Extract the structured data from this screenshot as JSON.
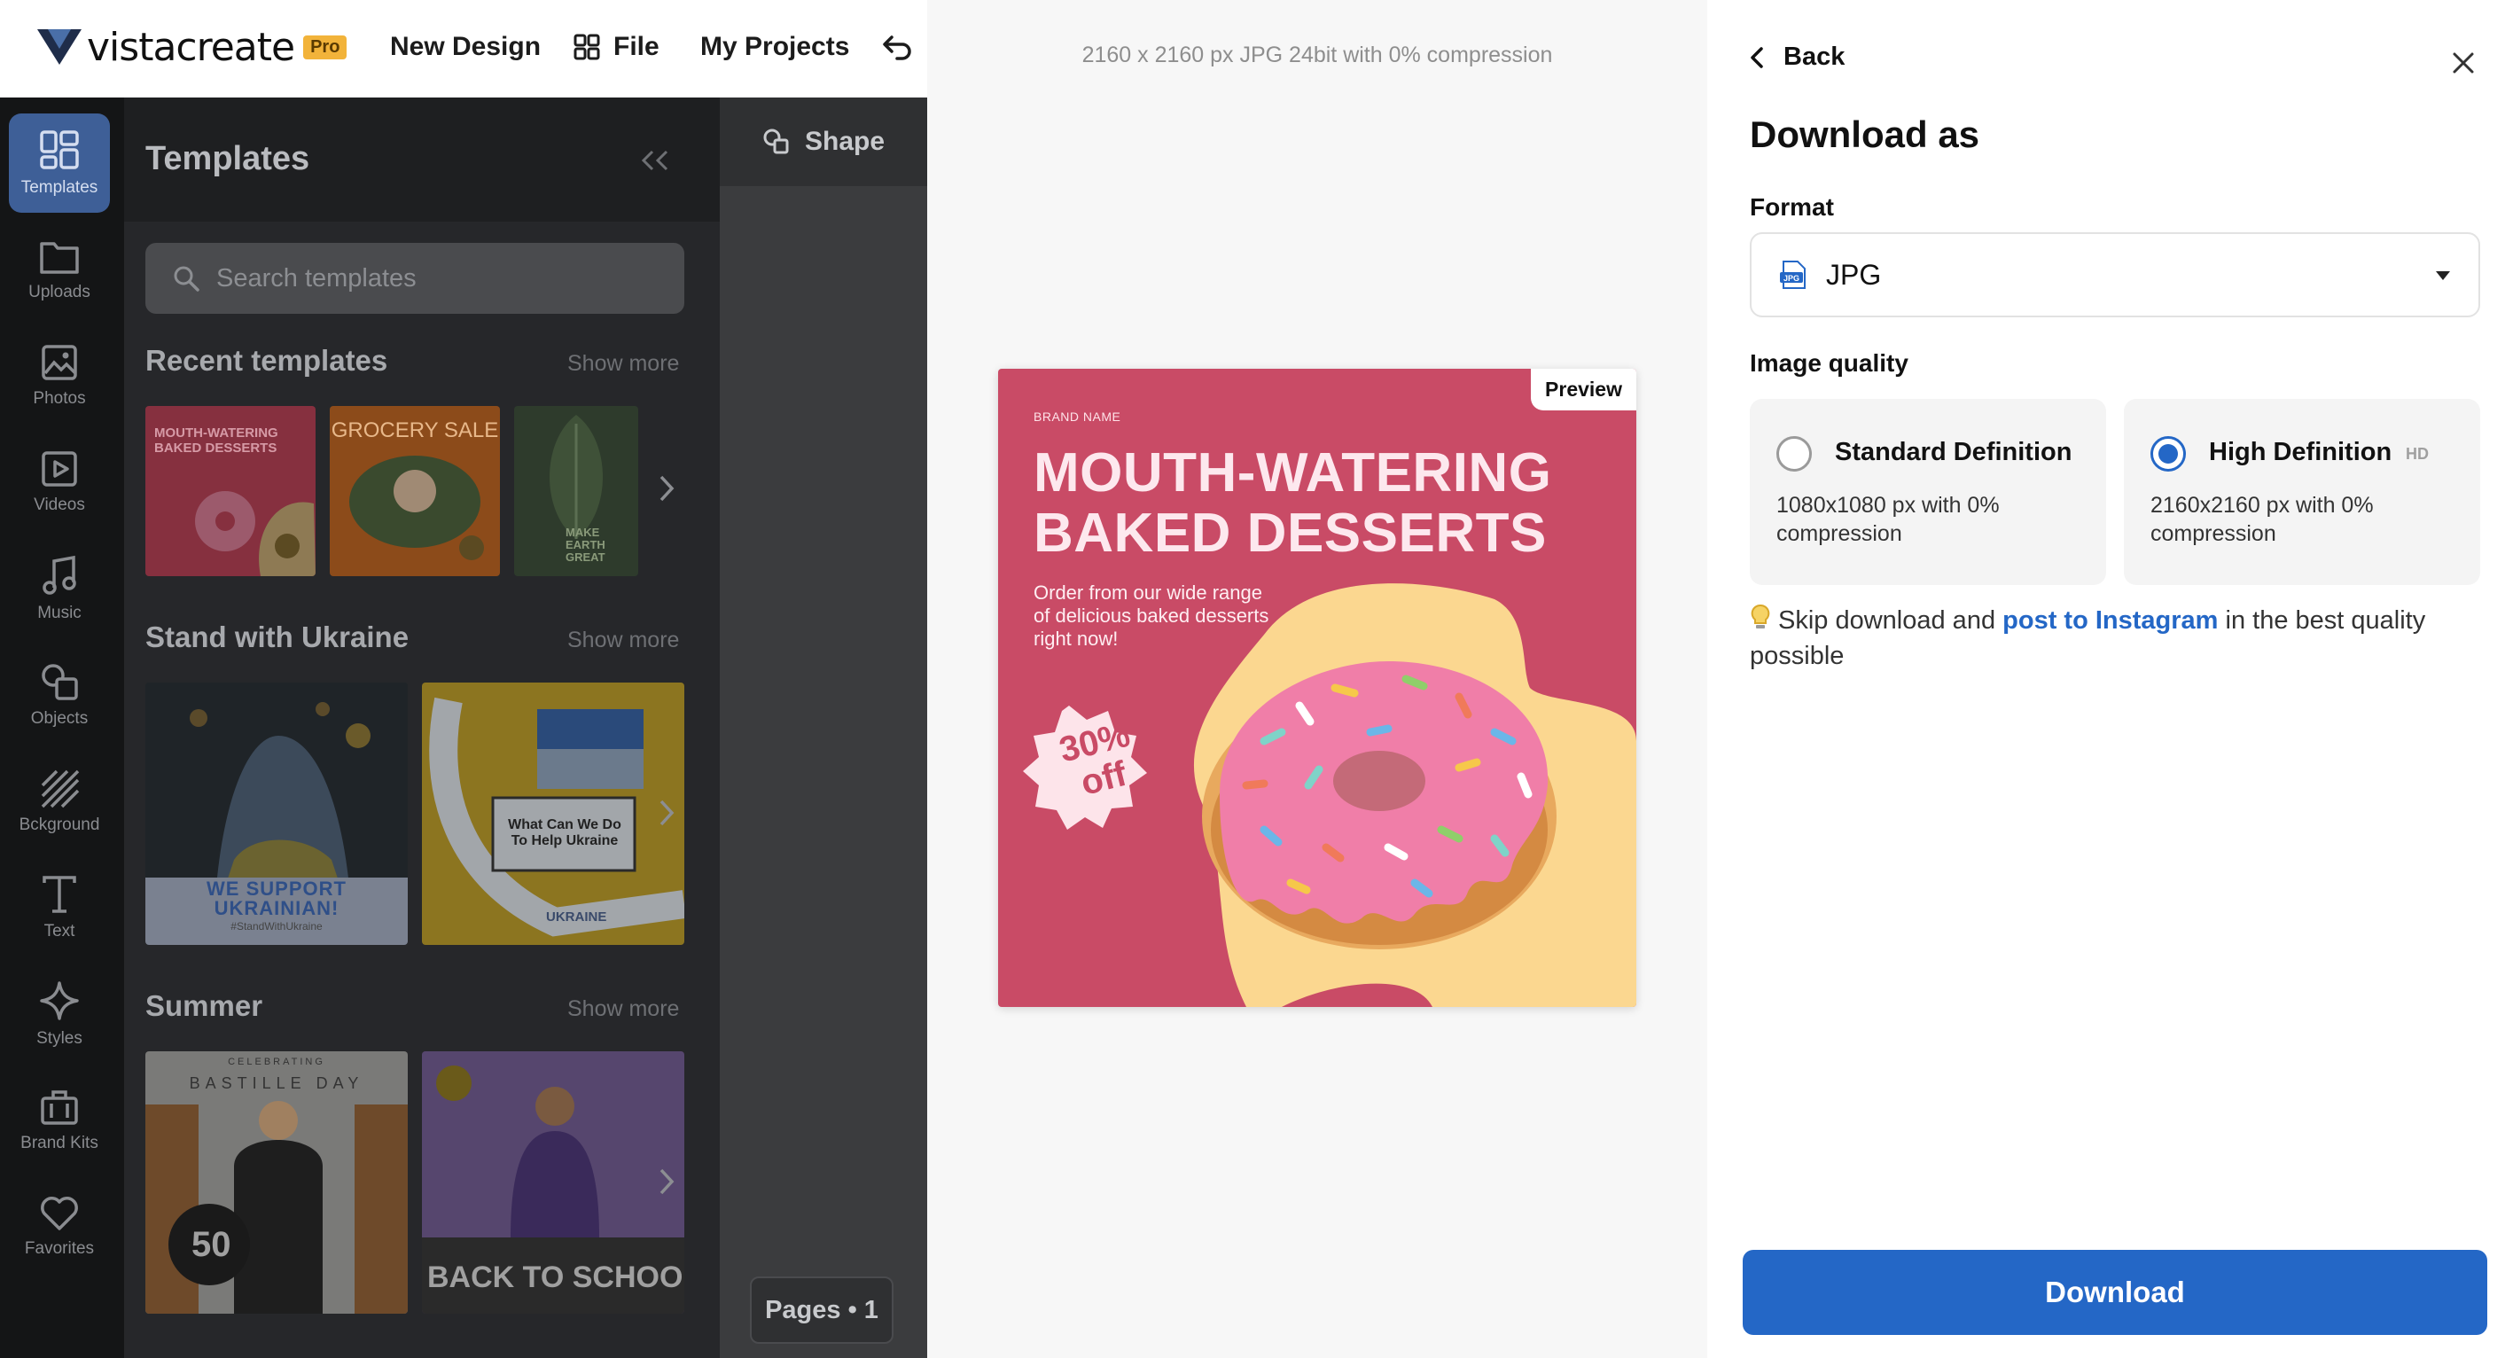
{
  "topbar": {
    "logo_text": "vistacreate",
    "pro_badge": "Pro",
    "new_design": "New Design",
    "file": "File",
    "my_projects": "My Projects"
  },
  "iconbar": {
    "items": [
      "Templates",
      "Uploads",
      "Photos",
      "Videos",
      "Music",
      "Objects",
      "Bckground",
      "Text",
      "Styles",
      "Brand Kits",
      "Favorites"
    ]
  },
  "templates_panel": {
    "title": "Templates",
    "search_placeholder": "Search templates",
    "sections": [
      {
        "title": "Recent templates",
        "more": "Show more"
      },
      {
        "title": "Stand with Ukraine",
        "more": "Show more"
      },
      {
        "title": "Summer",
        "more": "Show more"
      }
    ],
    "thumb_texts": {
      "mouth": "MOUTH-WATERING BAKED DESSERTS",
      "grocery": "GROCERY SALE",
      "make_earth": "MAKE EARTH GREAT",
      "we_support": "WE SUPPORT UKRAINIAN!",
      "hashtag": "#StandWithUkraine",
      "help": "What Can We Do To Help Ukraine",
      "ukraine": "UKRAINE",
      "bastille": "BASTILLE DAY",
      "celebrating": "CELEBRATING",
      "fifty": "50",
      "back_to_school": "BACK TO SCHOOL"
    }
  },
  "canvas": {
    "shape_label": "Shape",
    "pages_label": "Pages • 1"
  },
  "preview": {
    "file_info": "2160 x 2160 px JPG 24bit with 0% compression",
    "tag": "Preview",
    "brand": "BRAND NAME",
    "headline_1": "MOUTH-WATERING",
    "headline_2": "BAKED DESSERTS",
    "sub_1": "Order from our wide range",
    "sub_2": "of delicious baked desserts",
    "sub_3": "right now!",
    "discount_1": "30%",
    "discount_2": "off"
  },
  "download_panel": {
    "back": "Back",
    "title": "Download as",
    "format_label": "Format",
    "format_value": "JPG",
    "quality_label": "Image quality",
    "options": [
      {
        "name": "Standard Definition",
        "desc": "1080x1080 px with 0% compression",
        "selected": false
      },
      {
        "name": "High Definition",
        "tag": "HD",
        "desc": "2160x2160 px with 0% compression",
        "selected": true
      }
    ],
    "tip_prefix": "Skip download and ",
    "tip_link": "post to Instagram",
    "tip_suffix": " in the best quality possible",
    "download_button": "Download"
  },
  "colors": {
    "accent": "#2467c6",
    "poster_bg": "#c94b66",
    "blob": "#fbd790"
  }
}
